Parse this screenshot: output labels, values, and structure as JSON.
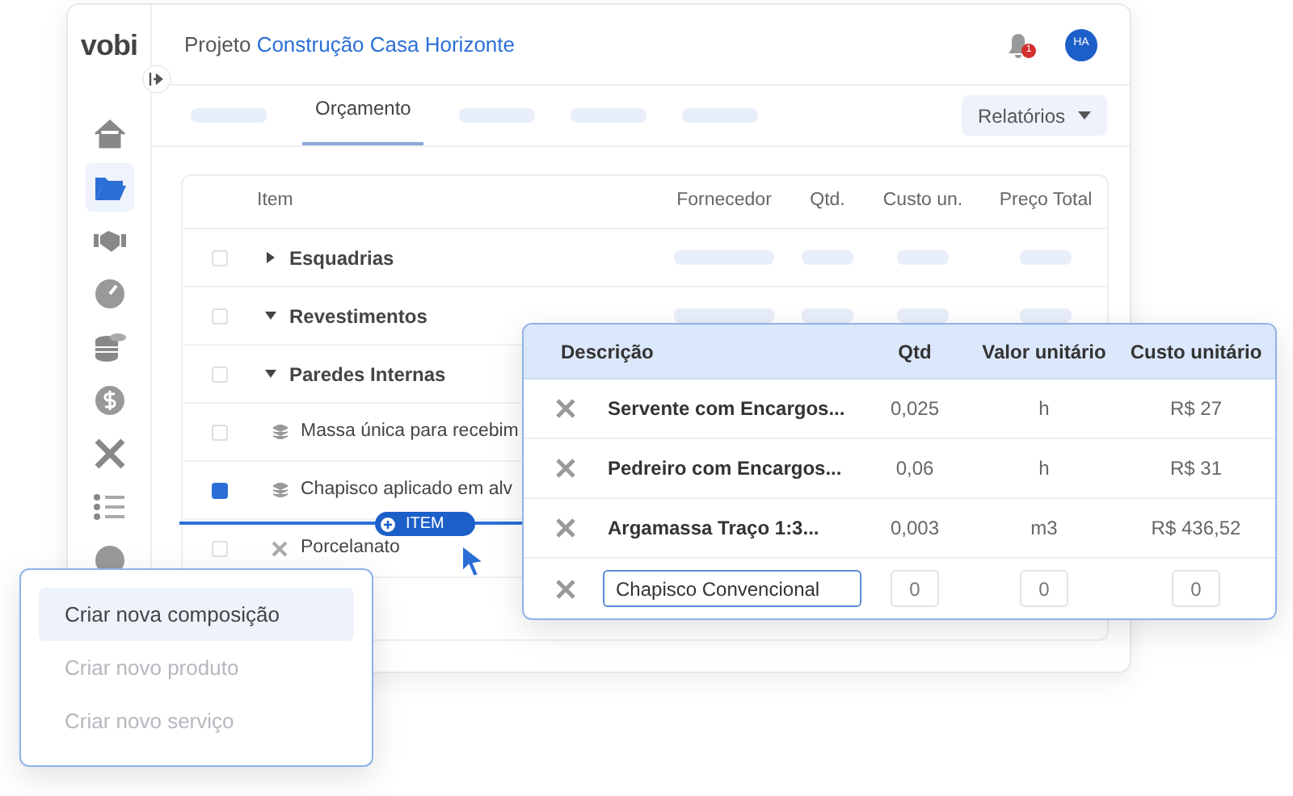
{
  "brand": "vobi",
  "sidebar": {
    "items": [
      {
        "selected": false
      },
      {
        "selected": true
      },
      {
        "selected": false
      },
      {
        "selected": false
      },
      {
        "selected": false
      },
      {
        "selected": false
      },
      {
        "selected": false
      },
      {
        "selected": false
      },
      {
        "selected": false
      }
    ]
  },
  "header": {
    "label": "Projeto",
    "project": "Construção Casa Horizonte",
    "notification_count": "1",
    "avatar": "HA"
  },
  "tabs": [
    {
      "kind": "skeleton",
      "selected": false
    },
    {
      "kind": "text",
      "label": "Orçamento",
      "selected": true
    },
    {
      "kind": "skeleton",
      "selected": false
    },
    {
      "kind": "skeleton",
      "selected": false
    },
    {
      "kind": "skeleton",
      "selected": false
    }
  ],
  "reports_button": "Relatórios",
  "table": {
    "columns": [
      "Item",
      "Fornecedor",
      "Qtd.",
      "Custo un.",
      "Preço Total"
    ],
    "rows": [
      {
        "kind": "group",
        "label": "Esquadrias",
        "expanded": false,
        "checked": false
      },
      {
        "kind": "group",
        "label": "Revestimentos",
        "expanded": true,
        "checked": false
      },
      {
        "kind": "group",
        "label": "Paredes Internas",
        "expanded": true,
        "checked": false
      },
      {
        "kind": "composition",
        "label": "Massa única para recebim",
        "checked": false
      },
      {
        "kind": "composition",
        "label": "Chapisco aplicado em alv",
        "checked": true
      },
      {
        "kind": "service",
        "label": "Porcelanato",
        "checked": false
      }
    ]
  },
  "drop_badge": "ITEM",
  "popup": {
    "columns": [
      "Descrição",
      "Qtd",
      "Valor unitário",
      "Custo unitário"
    ],
    "rows": [
      {
        "kind": "text",
        "description": "Servente com Encargos...",
        "qtd": "0,025",
        "unit": "h",
        "cost": "R$ 27"
      },
      {
        "kind": "text",
        "description": "Pedreiro com Encargos...",
        "qtd": "0,06",
        "unit": "h",
        "cost": "R$ 31"
      },
      {
        "kind": "text",
        "description": "Argamassa Traço 1:3...",
        "qtd": "0,003",
        "unit": "m3",
        "cost": "R$ 436,52"
      },
      {
        "kind": "input",
        "description": "Chapisco Convencional",
        "qtd": "0",
        "unit": "0",
        "cost": "0"
      }
    ]
  },
  "menu": {
    "items": [
      {
        "label": "Criar nova composição",
        "selected": true,
        "disabled": false
      },
      {
        "label": "Criar novo produto",
        "selected": false,
        "disabled": true
      },
      {
        "label": "Criar novo serviço",
        "selected": false,
        "disabled": true
      }
    ]
  }
}
